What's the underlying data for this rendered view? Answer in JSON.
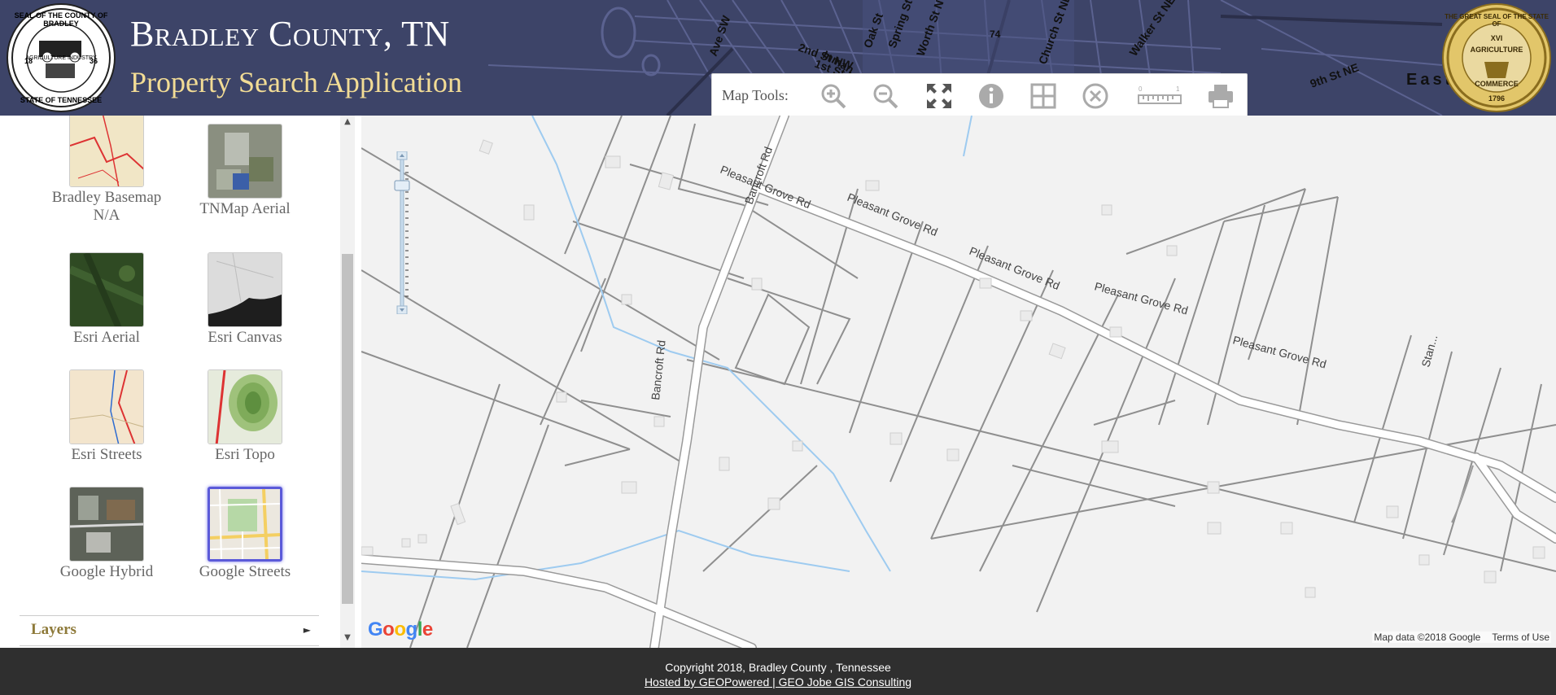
{
  "header": {
    "title": "Bradley County, TN",
    "subtitle": "Property Search Application",
    "seal_left": {
      "top": "SEAL OF THE COUNTY OF BRADLEY",
      "center": "AGRICULTURE INDUSTRY",
      "bottom": "STATE OF TENNESSEE",
      "year_left": "18",
      "year_right": "36"
    },
    "seal_right": {
      "top": "THE GREAT SEAL OF THE STATE OF",
      "center": "AGRICULTURE",
      "bottom": "COMMERCE",
      "numeral": "XVI",
      "year": "1796"
    },
    "bg_street_labels": [
      "2nd St NW",
      "1st St NW",
      "Oak St",
      "Spring St",
      "Worth St NW",
      "Church St NE",
      "Walker St NE",
      "9th St NE",
      "Inman",
      "Ave SW",
      "74",
      "East"
    ]
  },
  "map_tools": {
    "label": "Map Tools:",
    "tools": [
      {
        "name": "zoom-in-icon"
      },
      {
        "name": "zoom-out-icon"
      },
      {
        "name": "full-extent-icon"
      },
      {
        "name": "identify-icon"
      },
      {
        "name": "select-parcel-icon"
      },
      {
        "name": "clear-icon"
      },
      {
        "name": "measure-icon"
      },
      {
        "name": "print-icon"
      }
    ],
    "measure_ticks": [
      "0",
      "1"
    ]
  },
  "basemaps": [
    {
      "label": "Bradley Basemap N/A",
      "selected": false
    },
    {
      "label": "TNMap Aerial",
      "selected": false
    },
    {
      "label": "Esri Aerial",
      "selected": false
    },
    {
      "label": "Esri Canvas",
      "selected": false
    },
    {
      "label": "Esri Streets",
      "selected": false
    },
    {
      "label": "Esri Topo",
      "selected": false
    },
    {
      "label": "Google Hybrid",
      "selected": false
    },
    {
      "label": "Google Streets",
      "selected": true
    }
  ],
  "layers": {
    "label": "Layers",
    "arrow": "►"
  },
  "scrollbar": {
    "up": "▲",
    "down": "▼"
  },
  "map": {
    "roads": [
      "Bancroft Rd",
      "Pleasant Grove Rd",
      "Pleasant Grove Rd",
      "Pleasant Grove Rd",
      "Pleasant Grove Rd",
      "Pleasant Grove Rd",
      "Bancroft Rd",
      "Stan..."
    ],
    "google_logo": "Google",
    "attribution": "Map data ©2018 Google",
    "terms": "Terms of Use"
  },
  "footer": {
    "copyright": "Copyright 2018, Bradley County , Tennessee",
    "hosted": "Hosted by GEOPowered | GEO Jobe GIS Consulting"
  },
  "colors": {
    "header_bg": "#3d4468",
    "title": "#ffffff",
    "subtitle": "#f2dc95",
    "layers_label": "#8e7a3a",
    "footer_bg": "#2f2f2f",
    "selected_border": "#5b5ad9"
  }
}
